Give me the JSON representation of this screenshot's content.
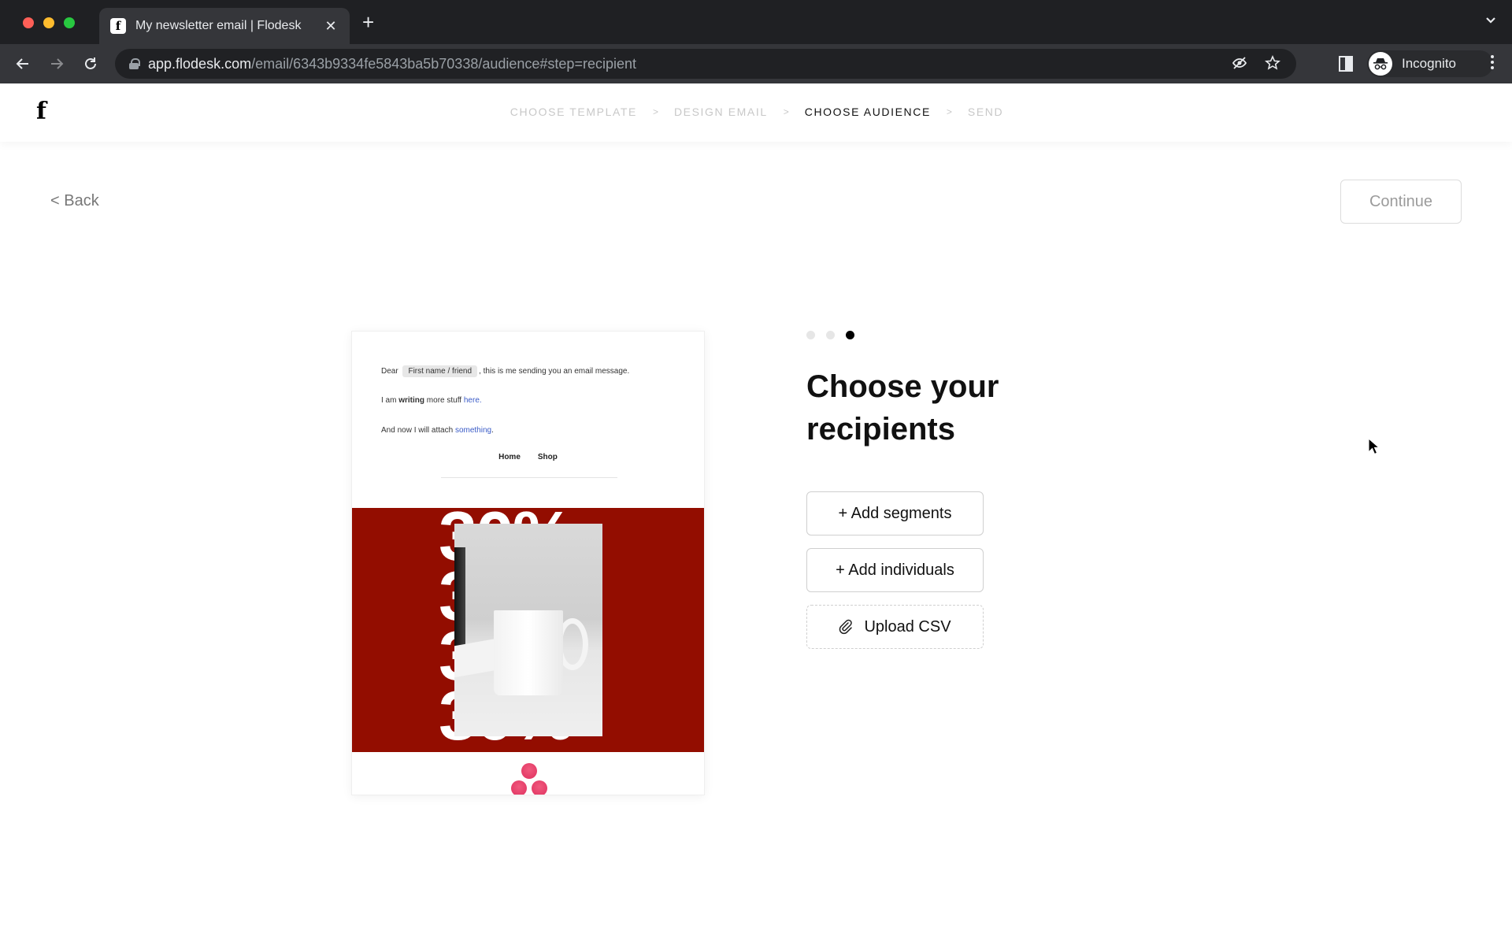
{
  "browser": {
    "tab_title": "My newsletter email | Flodesk",
    "tab_favicon": "f",
    "tab_close": "✕",
    "new_tab": "+",
    "tab_list": "⌄",
    "url_host": "app.flodesk.com",
    "url_path": "/email/6343b9334fe5843ba5b70338/audience#step=recipient",
    "profile_label": "Incognito",
    "icons": [
      "back-arrow-icon",
      "forward-arrow-icon",
      "reload-icon",
      "lock-icon",
      "eye-off-icon",
      "star-icon",
      "side-panel-icon",
      "incognito-icon",
      "more-menu-icon"
    ]
  },
  "app": {
    "logo": "f",
    "steps": [
      {
        "label": "CHOOSE TEMPLATE",
        "state": "done"
      },
      {
        "label": "DESIGN EMAIL",
        "state": "done"
      },
      {
        "label": "CHOOSE AUDIENCE",
        "state": "active"
      },
      {
        "label": "SEND",
        "state": "upcoming"
      }
    ],
    "step_separator": ">",
    "back_label": "< Back",
    "continue_label": "Continue"
  },
  "preview": {
    "line1_prefix": "Dear",
    "merge_tag": "First name / friend",
    "line1_suffix": ", this is me sending you an email message.",
    "line2_prefix": "I am",
    "line2_bold": "writing",
    "line2_middle": "more stuff",
    "line2_link": "here.",
    "line3_prefix": "And now I will attach",
    "line3_link": "something",
    "line3_suffix": ".",
    "nav": [
      "Home",
      "Shop"
    ],
    "banner_text": "30%",
    "banner_color": "#930d00"
  },
  "panel": {
    "pager": {
      "total": 3,
      "current": 3
    },
    "heading": "Choose your recipients",
    "buttons": {
      "add_segments": "+ Add segments",
      "add_individuals": "+ Add individuals",
      "upload_csv": "Upload CSV"
    }
  }
}
